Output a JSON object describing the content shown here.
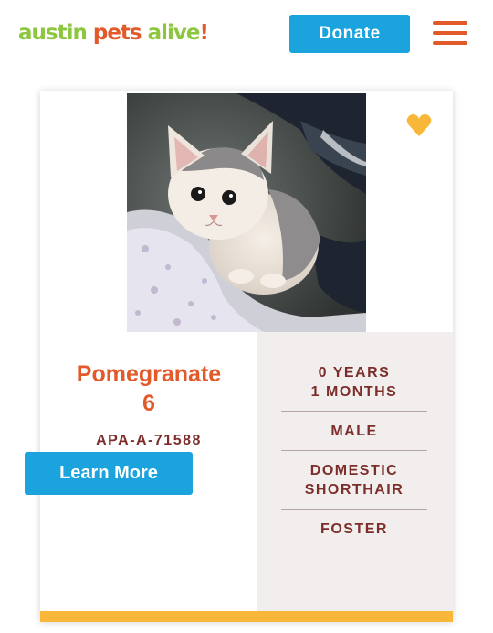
{
  "header": {
    "logo": {
      "word1": "austin",
      "word2": "pets",
      "word3": "alive",
      "punct": "!"
    },
    "donate_label": "Donate",
    "menu_icon": "hamburger-menu-icon"
  },
  "pet_card": {
    "photo_description_icon": "kitten-photo",
    "favorite_icon": "heart-icon",
    "name_line1": "Pomegranate",
    "name_line2": "6",
    "id": "APA-A-71588",
    "age_line1": "0 YEARS",
    "age_line2": "1 MONTHS",
    "sex": "MALE",
    "breed_line1": "DOMESTIC",
    "breed_line2": "SHORTHAIR",
    "status": "FOSTER",
    "learn_more_label": "Learn More"
  },
  "colors": {
    "accent_blue": "#1aa3dd",
    "brand_orange": "#e2592a",
    "brand_green": "#8dc63f",
    "text_maroon": "#7b2e2a",
    "footer_yellow": "#f9b73a",
    "panel_gray": "#f2eeee"
  }
}
